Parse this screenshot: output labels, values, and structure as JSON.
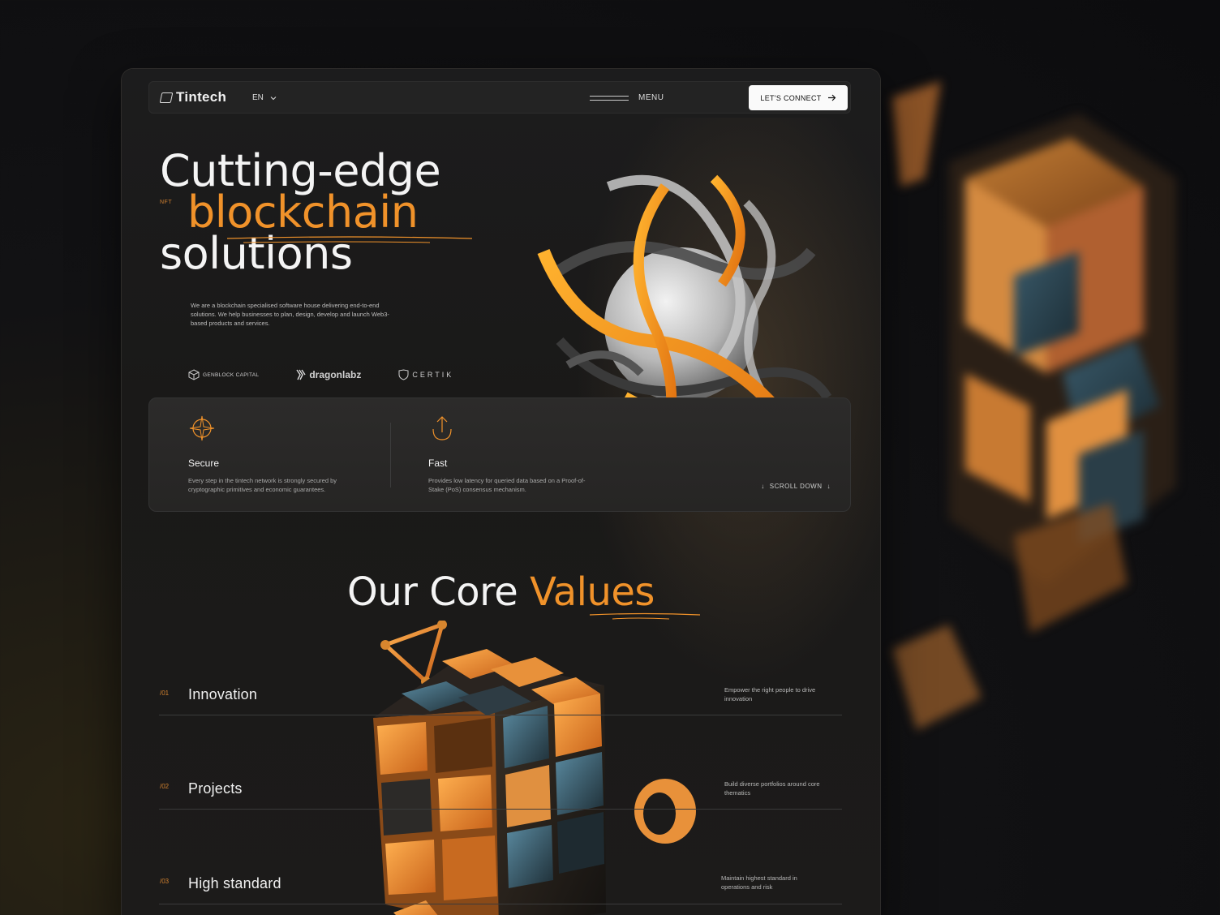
{
  "brand": {
    "name": "Tintech"
  },
  "nav": {
    "language": "EN",
    "menu_label": "MENU",
    "connect_label": "LET'S CONNECT"
  },
  "hero": {
    "tag": "NFT",
    "title_line1": "Cutting-edge",
    "title_line2": "blockchain",
    "title_line3": "solutions",
    "description": "We are a blockchain specialised software house delivering end-to-end solutions. We help businesses to plan, design, develop and launch Web3-based products and services."
  },
  "partners": [
    {
      "name": "GENBLOCK CAPITAL",
      "icon": "cube-icon"
    },
    {
      "name": "dragonlabz",
      "icon": "dragon-icon"
    },
    {
      "name": "CERTIK",
      "icon": "shield-icon"
    }
  ],
  "features": [
    {
      "title": "Secure",
      "description": "Every step in the tintech network is strongly secured by cryptographic primitives and economic guarantees.",
      "icon": "compass-star-icon"
    },
    {
      "title": "Fast",
      "description": "Provides low latency for queried data based on a Proof-of-Stake (PoS) consensus mechanism.",
      "icon": "upload-arrow-icon"
    }
  ],
  "scroll_label": "SCROLL DOWN",
  "core_values": {
    "title_plain": "Our Core",
    "title_accent": "Values",
    "items": [
      {
        "num": "/01",
        "title": "Innovation",
        "description": "Empower the right people to drive innovation"
      },
      {
        "num": "/02",
        "title": "Projects",
        "description": "Build diverse portfolios around core thematics"
      },
      {
        "num": "/03",
        "title": "High standard",
        "description": "Maintain highest standard in operations and risk"
      }
    ]
  },
  "colors": {
    "accent": "#f0922a",
    "background": "#121214",
    "panel": "#1c1c1d"
  }
}
